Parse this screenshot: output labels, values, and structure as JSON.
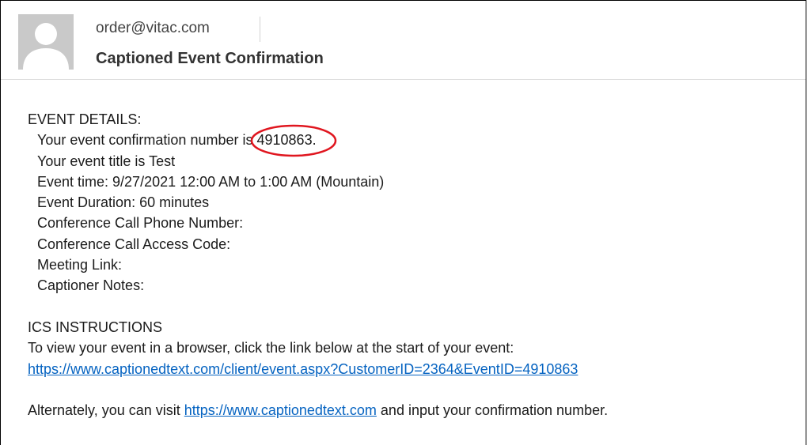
{
  "email": {
    "sender": "order@vitac.com",
    "subject": "Captioned Event Confirmation"
  },
  "body": {
    "event_details_heading": "EVENT DETAILS:",
    "confirmation_prefix": "Your event confirmation number is",
    "confirmation_number": "4910863.",
    "event_title": "Your event title is Test",
    "event_time": "Event time: 9/27/2021 12:00 AM to 1:00 AM (Mountain)",
    "event_duration": "Event Duration: 60 minutes",
    "conference_phone": "Conference Call Phone Number:",
    "conference_code": "Conference Call Access Code:",
    "meeting_link": "Meeting Link:",
    "captioner_notes": "Captioner Notes:",
    "ics_heading": "ICS INSTRUCTIONS",
    "ics_instruction": "To view your event in a browser, click the link below at the start of your event:",
    "event_url": "https://www.captionedtext.com/client/event.aspx?CustomerID=2364&EventID=4910863",
    "alt_prefix": "Alternately, you can visit",
    "site_url": "https://www.captionedtext.com",
    "alt_suffix": "and input your confirmation number."
  },
  "colors": {
    "link": "#0563c1",
    "highlight_circle": "#e0161f",
    "avatar_bg": "#c9c9c9"
  },
  "icons": {
    "avatar": "person-silhouette-icon"
  }
}
